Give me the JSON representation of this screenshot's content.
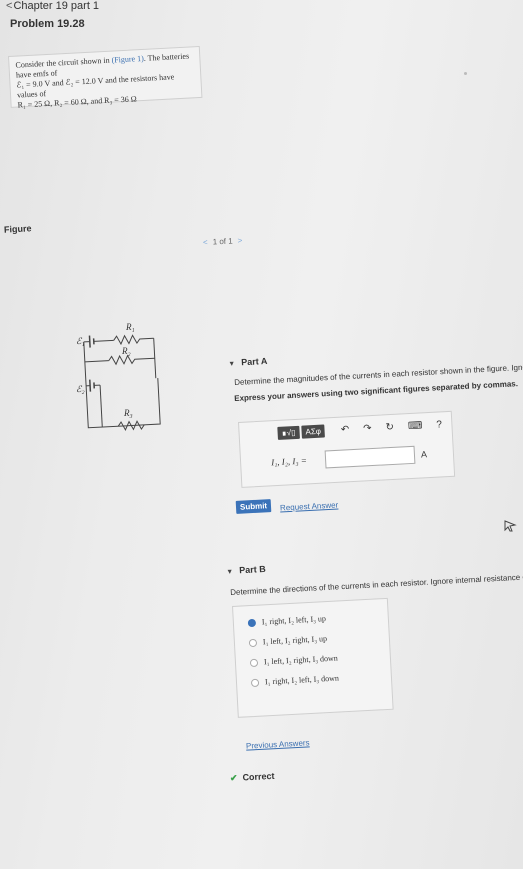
{
  "breadcrumb": {
    "chevron": "<",
    "text": "Chapter 19 part 1"
  },
  "problem": {
    "title": "Problem 19.28"
  },
  "intro": {
    "line1_a": "Consider the circuit shown in ",
    "line1_link": "(Figure 1)",
    "line1_b": ". The batteries have emfs of",
    "line2": "ℰ₁ = 9.0 V and ℰ₂ = 12.0 V and the resistors have values of",
    "line3": "R₁ = 25 Ω, R₂ = 60 Ω, and R₃ = 36 Ω"
  },
  "figure": {
    "label": "Figure",
    "prev": "<",
    "counter": "1 of 1",
    "next": ">",
    "labels": {
      "r1": "R₁",
      "r2": "R₂",
      "r3": "R₃",
      "e1": "ℰ₁",
      "e2": "ℰ₂"
    }
  },
  "partA": {
    "caret": "▼",
    "title": "Part A",
    "prompt_line1": "Determine the magnitudes of the currents in each resistor shown in the figure. Ignore internal resistance of the batteries.",
    "prompt_line2": "Express your answers using two significant figures separated by commas.",
    "toolbar": {
      "templates": "∎√▯",
      "greek": "ΑΣφ",
      "undo_icon": "undo-icon",
      "redo_icon": "redo-icon",
      "reset_icon": "reset-icon",
      "keyboard_icon": "keyboard-icon",
      "help": "?"
    },
    "eq_label": "I₁, I₂, I₃ =",
    "input_value": "",
    "unit": "A",
    "submit": "Submit",
    "request": "Request Answer"
  },
  "partB": {
    "caret": "▼",
    "title": "Part B",
    "prompt": "Determine the directions of the currents in each resistor. Ignore internal resistance of the batteries.",
    "choices": [
      {
        "text": "I₁ right, I₂ left, I₃ up",
        "selected": true
      },
      {
        "text": "I₁ left, I₂ right, I₃ up",
        "selected": false
      },
      {
        "text": "I₁ left, I₂ right, I₃ down",
        "selected": false
      },
      {
        "text": "I₁ right, I₂ left, I₃ down",
        "selected": false
      }
    ],
    "previous_answers": "Previous Answers",
    "correct": "Correct"
  },
  "colors": {
    "accent": "#3b73b9",
    "link": "#3a6fb0",
    "correct": "#3aa14a"
  }
}
